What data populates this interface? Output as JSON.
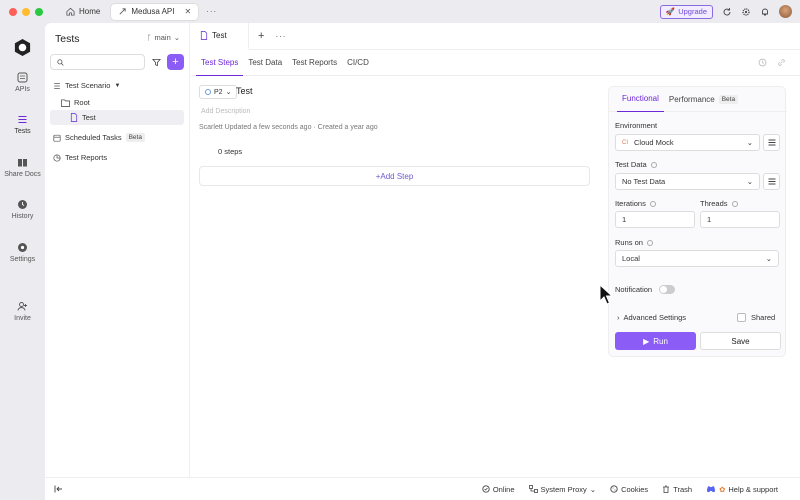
{
  "titlebar": {
    "tabs": [
      {
        "label": "Home",
        "icon": "home-icon"
      },
      {
        "label": "Medusa API",
        "icon": "api-icon"
      }
    ],
    "upgrade_label": "Upgrade"
  },
  "nav": {
    "items": [
      {
        "label": "APIs"
      },
      {
        "label": "Tests"
      },
      {
        "label": "Share Docs"
      },
      {
        "label": "History"
      },
      {
        "label": "Settings"
      },
      {
        "label": "Invite"
      }
    ]
  },
  "sidebar": {
    "title": "Tests",
    "branch": "main",
    "search_placeholder": "",
    "tree": [
      {
        "label": "Test Scenario"
      },
      {
        "label": "Root"
      },
      {
        "label": "Test"
      },
      {
        "label": "Scheduled Tasks",
        "badge": "Beta"
      },
      {
        "label": "Test Reports"
      }
    ]
  },
  "editor": {
    "tab_label": "Test",
    "subtabs": [
      "Test Steps",
      "Test Data",
      "Test Reports",
      "CI/CD"
    ],
    "priority": "P2",
    "title": "Test",
    "description_placeholder": "Add Description",
    "meta": "Scarlett Updated a few seconds ago · Created a year ago",
    "steps_count": "0 steps",
    "add_step_label": "Add Step"
  },
  "run_panel": {
    "tabs": [
      "Functional",
      "Performance"
    ],
    "performance_badge": "Beta",
    "environment_label": "Environment",
    "environment_value": "Cloud Mock",
    "environment_prefix": "CI",
    "test_data_label": "Test Data",
    "test_data_value": "No Test Data",
    "iterations_label": "Iterations",
    "iterations_value": "1",
    "threads_label": "Threads",
    "threads_value": "1",
    "runs_on_label": "Runs on",
    "runs_on_value": "Local",
    "notification_label": "Notification",
    "advanced_label": "Advanced Settings",
    "shared_label": "Shared",
    "run_label": "Run",
    "save_label": "Save"
  },
  "statusbar": {
    "online": "Online",
    "proxy": "System Proxy",
    "cookies": "Cookies",
    "trash": "Trash",
    "help": "Help & support"
  },
  "colors": {
    "accent": "#8b5cf6",
    "accent_text": "#6d28d9"
  }
}
